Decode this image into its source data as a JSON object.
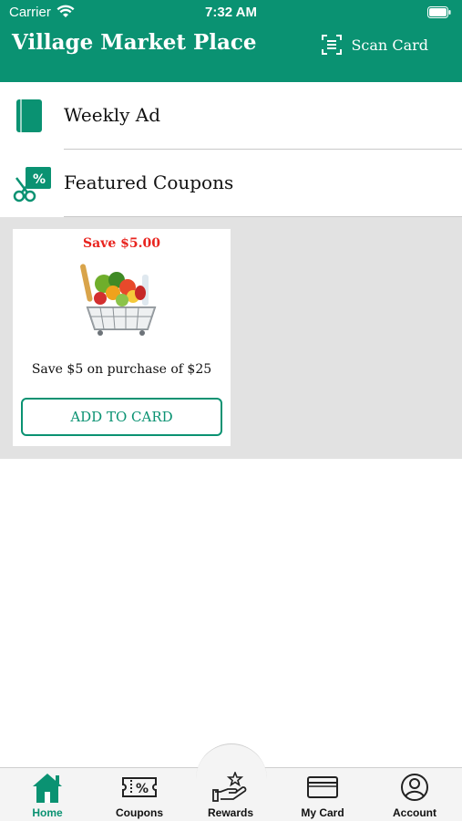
{
  "status_bar": {
    "carrier": "Carrier",
    "time": "7:32 AM"
  },
  "header": {
    "title": "Village Market Place",
    "scan_label": "Scan Card"
  },
  "menu": {
    "items": [
      {
        "label": "Weekly Ad",
        "icon": "book-icon"
      },
      {
        "label": "Featured Coupons",
        "icon": "coupon-scissors-icon"
      }
    ]
  },
  "coupons": [
    {
      "save": "Save $5.00",
      "description": "Save $5 on purchase of $25",
      "button": "ADD TO CARD",
      "image": "grocery-basket"
    }
  ],
  "tabs": [
    {
      "label": "Home",
      "icon": "home-icon",
      "active": true
    },
    {
      "label": "Coupons",
      "icon": "ticket-percent-icon",
      "active": false
    },
    {
      "label": "Rewards",
      "icon": "hand-star-icon",
      "active": false
    },
    {
      "label": "My Card",
      "icon": "card-icon",
      "active": false
    },
    {
      "label": "Account",
      "icon": "account-icon",
      "active": false
    }
  ],
  "colors": {
    "brand": "#0a9272",
    "save_red": "#e8231e",
    "grey_bg": "#e2e2e2"
  }
}
